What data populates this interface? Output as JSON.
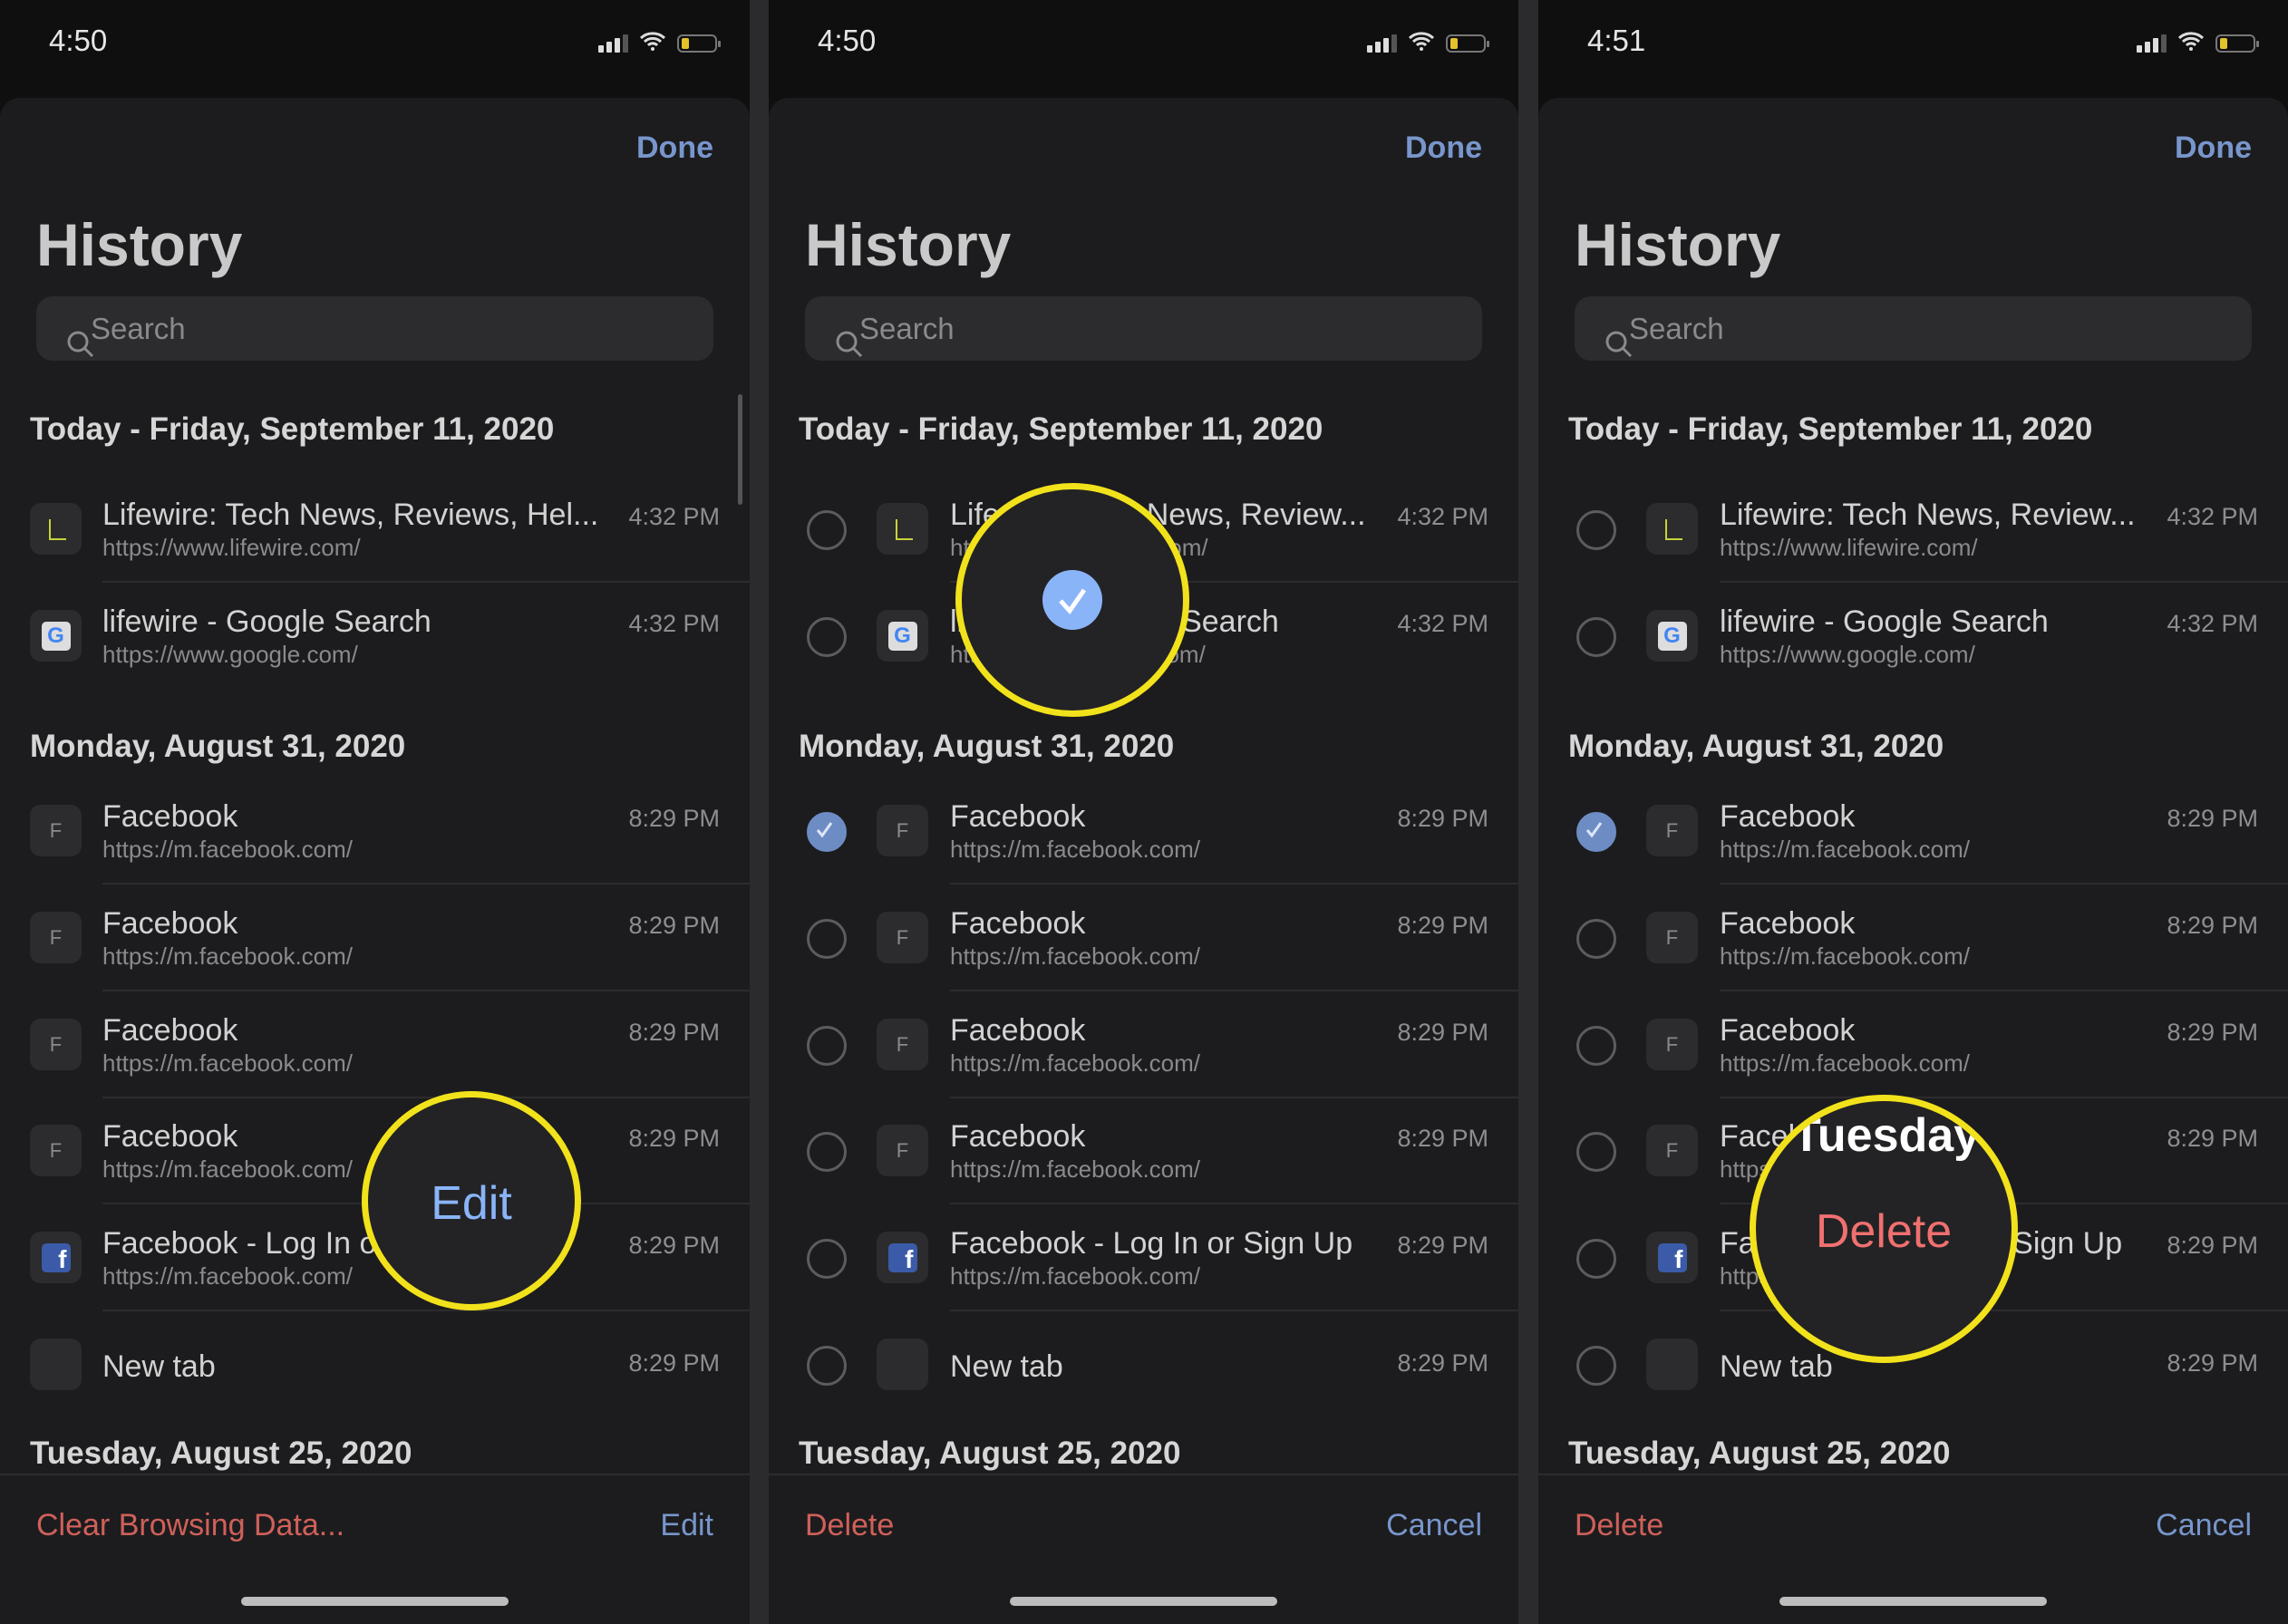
{
  "colors": {
    "accent": "#7896cc",
    "destructive": "#d0605a",
    "callout": "#f2e21b",
    "selected": "#6e8cc4"
  },
  "panels": [
    {
      "status_time": "4:50",
      "done_label": "Done",
      "title": "History",
      "search_placeholder": "Search",
      "edit_mode": false,
      "toolbar": {
        "left": "Clear Browsing Data...",
        "right": "Edit"
      },
      "callout": {
        "text": "Edit",
        "color": "#8ab4f8"
      }
    },
    {
      "status_time": "4:50",
      "done_label": "Done",
      "title": "History",
      "search_placeholder": "Search",
      "edit_mode": true,
      "toolbar": {
        "left": "Delete",
        "right": "Cancel"
      },
      "callout": {
        "icon": "checkmark-circle-icon"
      }
    },
    {
      "status_time": "4:51",
      "done_label": "Done",
      "title": "History",
      "search_placeholder": "Search",
      "edit_mode": true,
      "toolbar": {
        "left": "Delete",
        "right": "Cancel"
      },
      "callout": {
        "text": "Delete",
        "color": "#f07070",
        "peek": "Tuesday"
      }
    }
  ],
  "sections": [
    {
      "header": "Today - Friday, September 11, 2020",
      "rows": [
        {
          "title": "Lifewire: Tech News, Reviews, Hel...",
          "title_edit": "Lifewire: Tech News, Review...",
          "url": "https://www.lifewire.com/",
          "time": "4:32 PM",
          "icon": "lifewire-icon"
        },
        {
          "title": "lifewire - Google Search",
          "url": "https://www.google.com/",
          "time": "4:32 PM",
          "icon": "google-icon"
        }
      ]
    },
    {
      "header": "Monday, August 31, 2020",
      "rows": [
        {
          "title": "Facebook",
          "url": "https://m.facebook.com/",
          "time": "8:29 PM",
          "icon": "letter-f-icon",
          "selected": true
        },
        {
          "title": "Facebook",
          "url": "https://m.facebook.com/",
          "time": "8:29 PM",
          "icon": "letter-f-icon"
        },
        {
          "title": "Facebook",
          "url": "https://m.facebook.com/",
          "time": "8:29 PM",
          "icon": "letter-f-icon"
        },
        {
          "title": "Facebook",
          "url": "https://m.facebook.com/",
          "time": "8:29 PM",
          "icon": "letter-f-icon"
        },
        {
          "title": "Facebook - Log In or Sign Up",
          "url": "https://m.facebook.com/",
          "time": "8:29 PM",
          "icon": "facebook-icon"
        },
        {
          "title": "New tab",
          "url": "",
          "time": "8:29 PM",
          "icon": "blank-page-icon"
        }
      ]
    },
    {
      "header": "Tuesday, August 25, 2020",
      "rows": []
    }
  ]
}
